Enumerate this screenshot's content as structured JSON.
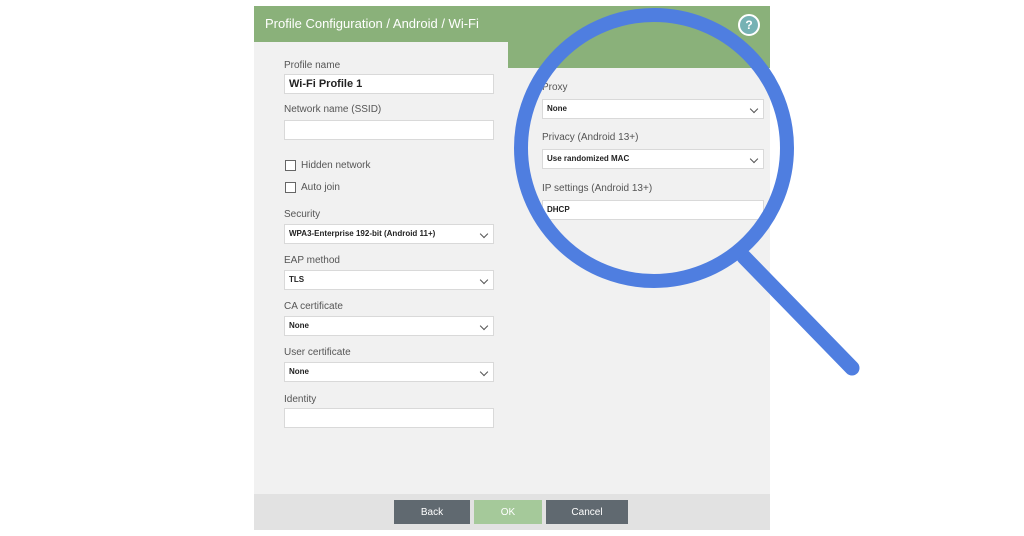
{
  "dialog": {
    "breadcrumb": "Profile Configuration / Android / Wi-Fi",
    "help_symbol": "?"
  },
  "left": {
    "profile_name_label": "Profile name",
    "profile_name_value": "Wi-Fi Profile 1",
    "ssid_label": "Network name (SSID)",
    "ssid_value": "",
    "hidden_network_label": "Hidden network",
    "auto_join_label": "Auto join",
    "security_label": "Security",
    "security_value": "WPA3-Enterprise 192-bit (Android 11+)",
    "eap_label": "EAP method",
    "eap_value": "TLS",
    "ca_label": "CA certificate",
    "ca_value": "None",
    "user_cert_label": "User certificate",
    "user_cert_value": "None",
    "identity_label": "Identity",
    "identity_value": ""
  },
  "right": {
    "proxy_label": "Proxy",
    "proxy_value": "None",
    "privacy_label": "Privacy (Android 13+)",
    "privacy_value": "Use randomized MAC",
    "ip_label": "IP settings (Android 13+)",
    "ip_value": "DHCP"
  },
  "footer": {
    "back_label": "Back",
    "ok_label": "OK",
    "cancel_label": "Cancel"
  },
  "colors": {
    "title_bar": "#8ab17a",
    "magnifier": "#4f7ee0",
    "ok_button": "#a5c99a",
    "nav_button": "#606970"
  },
  "overlay": {
    "icon": "magnifying-glass-icon"
  }
}
